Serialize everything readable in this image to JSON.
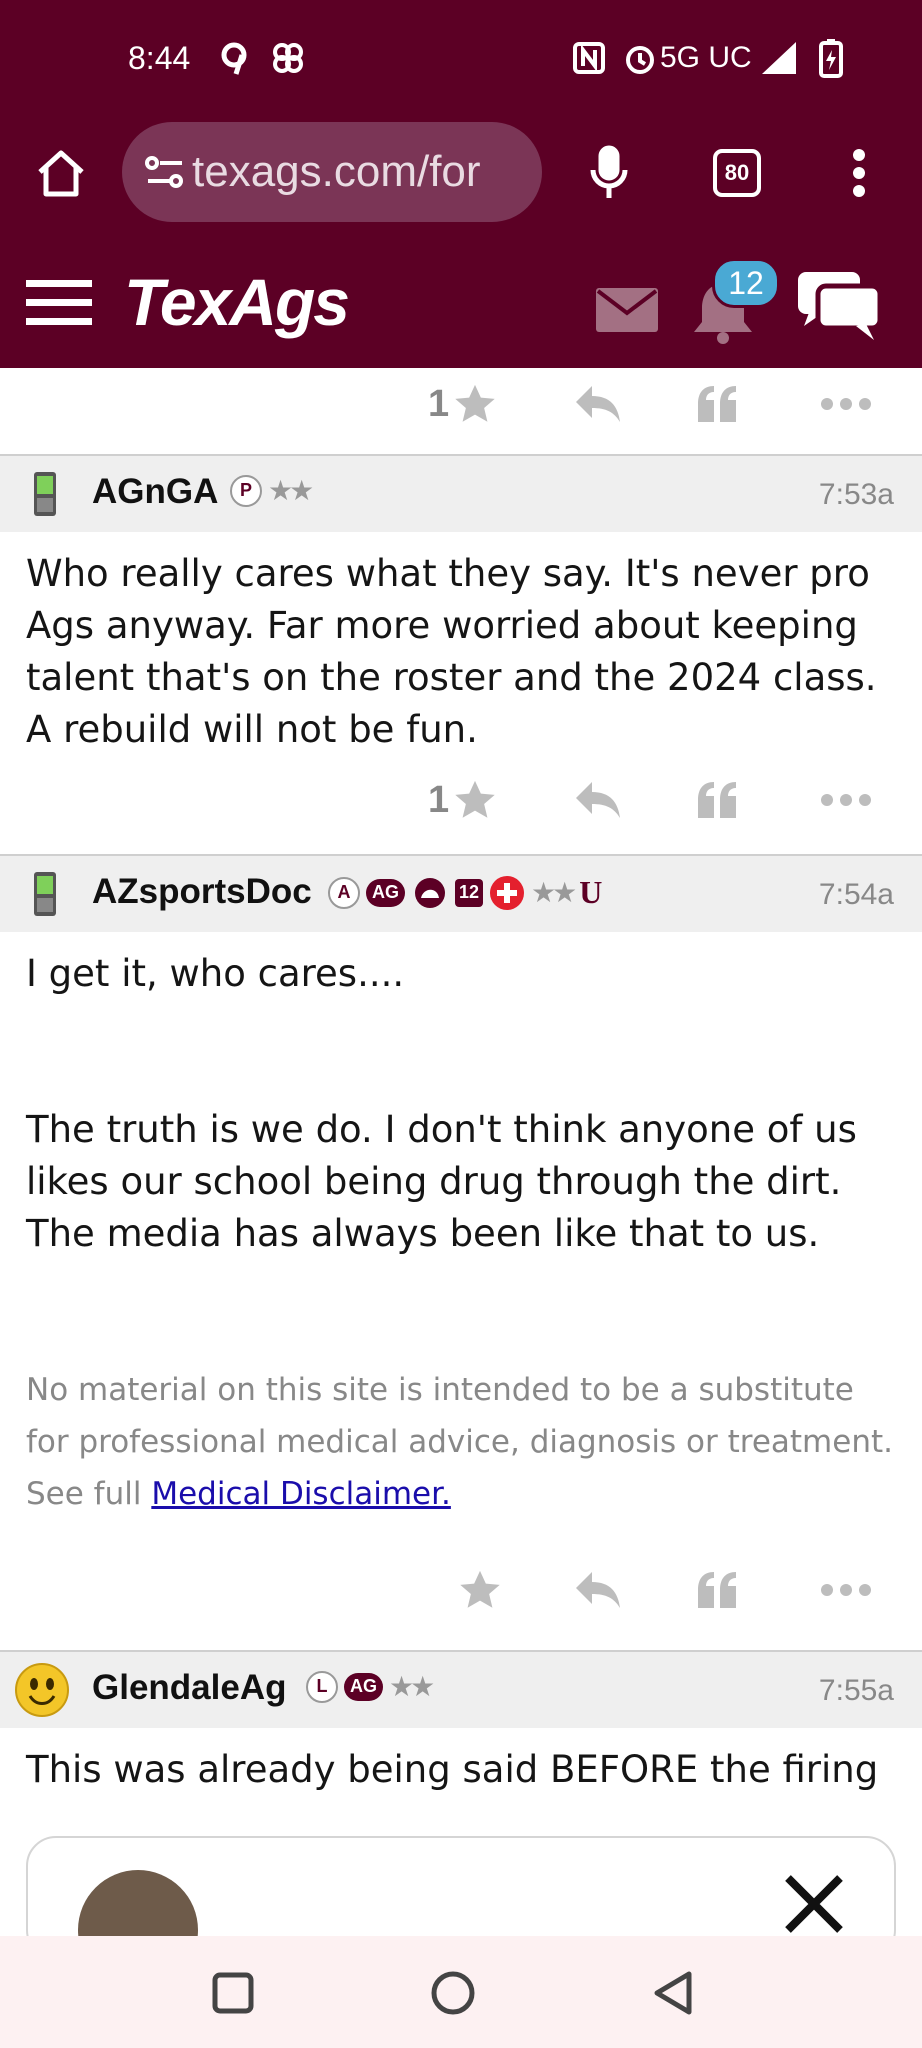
{
  "status_bar": {
    "time": "8:44",
    "network": "5G UC"
  },
  "browser": {
    "url_text": "texags.com/for",
    "tab_count": "80"
  },
  "site": {
    "logo_text": "TexAgs",
    "notification_count": "12"
  },
  "previous_post": {
    "star_count": "1"
  },
  "posts": [
    {
      "username": "AGnGA",
      "badges": [
        "P"
      ],
      "time": "7:53a",
      "body": "Who really cares what they say. It's never pro Ags anyway. Far more worried about keeping talent that's on the roster and the 2024 class. A rebuild will not be fun.",
      "star_count": "1"
    },
    {
      "username": "AZsportsDoc",
      "badges": [
        "A",
        "AG",
        "12",
        "U"
      ],
      "time": "7:54a",
      "body_p1": "I get it, who cares....",
      "body_p2": "The truth is we do. I don't think anyone of us likes our school being drug through the dirt. The media has always been like that to us.",
      "disclaimer_text": "No material on this site is intended to be a substitute for professional medical advice, diagnosis or treatment. See full ",
      "disclaimer_link": "Medical Disclaimer."
    },
    {
      "username": "GlendaleAg",
      "badges": [
        "L",
        "AG"
      ],
      "time": "7:55a",
      "body": "This was already being said BEFORE the firing"
    }
  ],
  "colors": {
    "brand": "#5c0025",
    "notification_badge": "#4aa9d4",
    "link": "#1a0dab"
  }
}
